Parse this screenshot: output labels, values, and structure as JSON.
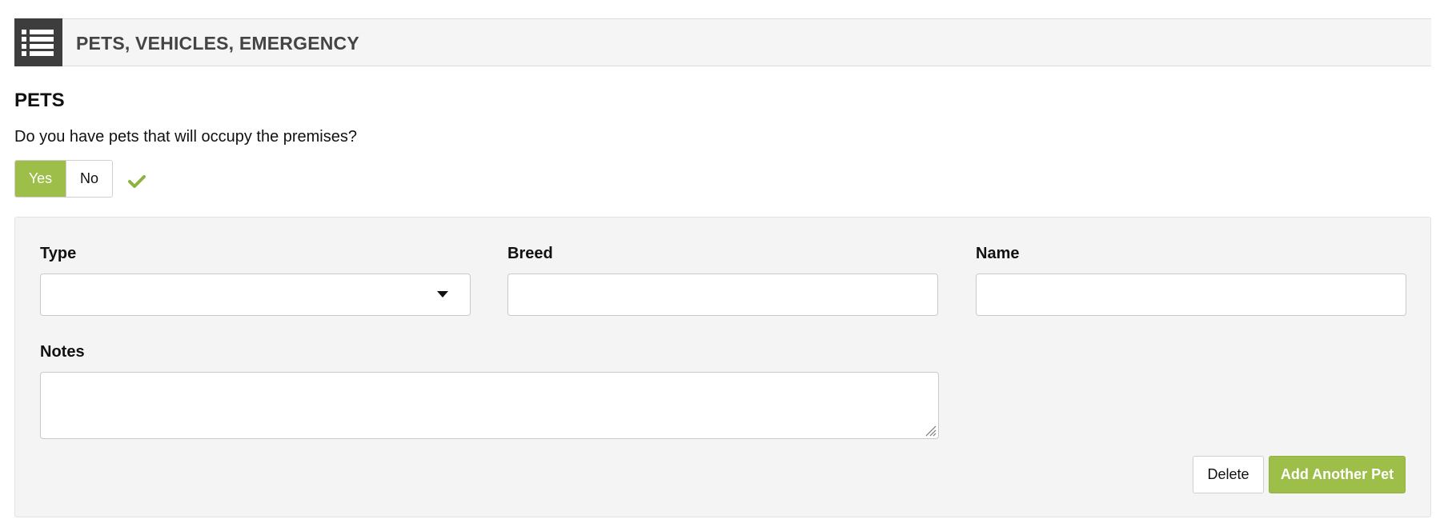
{
  "section": {
    "title": "PETS, VEHICLES, EMERGENCY",
    "icon": "list-icon"
  },
  "pets": {
    "title": "PETS",
    "question": "Do you have pets that will occupy the premises?",
    "toggle": {
      "yes_label": "Yes",
      "no_label": "No",
      "selected": "Yes"
    },
    "valid_icon": "checkmark-icon"
  },
  "pet_form": {
    "type_label": "Type",
    "type_value": "",
    "breed_label": "Breed",
    "breed_value": "",
    "name_label": "Name",
    "name_value": "",
    "notes_label": "Notes",
    "notes_value": "",
    "delete_label": "Delete",
    "add_label": "Add Another Pet"
  },
  "colors": {
    "accent": "#9dbf4a",
    "header_icon_bg": "#3d3d3d",
    "panel_bg": "#f4f4f4"
  }
}
